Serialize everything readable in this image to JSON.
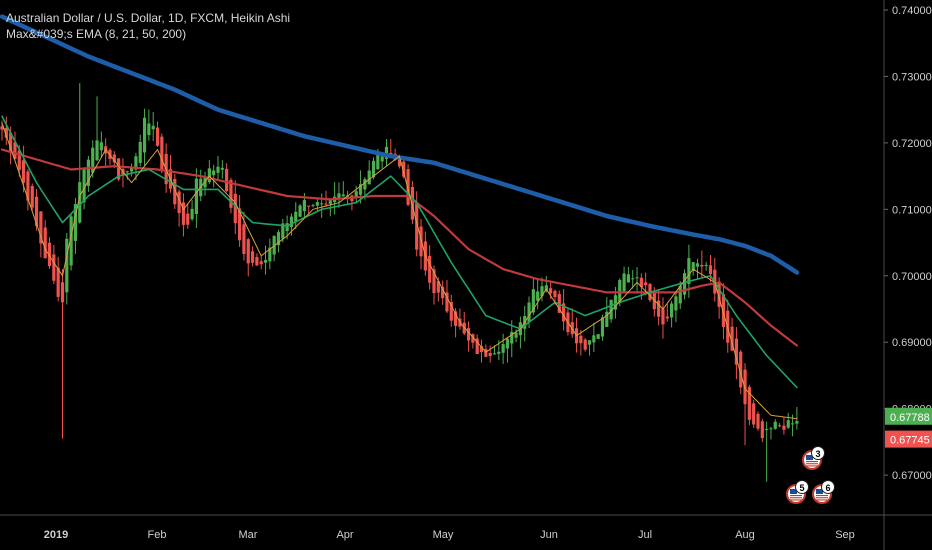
{
  "legend": {
    "symbol_line": "Australian Dollar / U.S. Dollar, 1D, FXCM, Heikin Ashi",
    "indicator_line": "Max&#039;s EMA (8, 21, 50, 200)"
  },
  "colors": {
    "background": "#000000",
    "up": "#4caf50",
    "down": "#ef5350",
    "ema8": "#d8a23a",
    "ema21": "#1fa366",
    "ema50": "#c0393b",
    "ema200": "#1e5ea8",
    "price_up_tag": "#4caf50",
    "price_down_tag": "#ef5350"
  },
  "chart_data": {
    "type": "candlestick",
    "style": "Heikin Ashi",
    "symbol": "AUDUSD",
    "timeframe": "1D",
    "ylim": [
      0.664,
      0.7415
    ],
    "y_ticks": [
      0.67,
      0.68,
      0.69,
      0.7,
      0.71,
      0.72,
      0.73,
      0.74
    ],
    "y_tick_labels": [
      "0.67000",
      "0.68000",
      "0.69000",
      "0.70000",
      "0.71000",
      "0.72000",
      "0.73000",
      "0.74000"
    ],
    "x_ticks": [
      "2019",
      "Feb",
      "Mar",
      "Apr",
      "May",
      "Jun",
      "Jul",
      "Aug",
      "Sep"
    ],
    "price_tags": [
      {
        "label": "0.67788",
        "value": 0.67788,
        "color": "up"
      },
      {
        "label": "0.67745",
        "value": 0.67745,
        "color": "down"
      }
    ],
    "close_keypoints": [
      [
        0,
        0.722
      ],
      [
        3,
        0.718
      ],
      [
        6,
        0.712
      ],
      [
        9,
        0.705
      ],
      [
        12,
        0.699
      ],
      [
        14,
        0.696
      ],
      [
        15,
        0.706
      ],
      [
        18,
        0.714
      ],
      [
        21,
        0.72
      ],
      [
        24,
        0.719
      ],
      [
        27,
        0.715
      ],
      [
        30,
        0.716
      ],
      [
        33,
        0.723
      ],
      [
        35,
        0.723
      ],
      [
        37,
        0.716
      ],
      [
        40,
        0.711
      ],
      [
        43,
        0.707
      ],
      [
        45,
        0.714
      ],
      [
        48,
        0.716
      ],
      [
        51,
        0.716
      ],
      [
        54,
        0.708
      ],
      [
        57,
        0.702
      ],
      [
        60,
        0.701
      ],
      [
        63,
        0.706
      ],
      [
        66,
        0.708
      ],
      [
        69,
        0.711
      ],
      [
        72,
        0.711
      ],
      [
        75,
        0.71
      ],
      [
        78,
        0.712
      ],
      [
        81,
        0.712
      ],
      [
        84,
        0.715
      ],
      [
        87,
        0.718
      ],
      [
        90,
        0.719
      ],
      [
        93,
        0.715
      ],
      [
        96,
        0.704
      ],
      [
        99,
        0.699
      ],
      [
        102,
        0.696
      ],
      [
        105,
        0.693
      ],
      [
        108,
        0.69
      ],
      [
        111,
        0.688
      ],
      [
        114,
        0.689
      ],
      [
        117,
        0.69
      ],
      [
        120,
        0.693
      ],
      [
        123,
        0.698
      ],
      [
        126,
        0.699
      ],
      [
        129,
        0.695
      ],
      [
        132,
        0.691
      ],
      [
        135,
        0.6895
      ],
      [
        138,
        0.692
      ],
      [
        141,
        0.696
      ],
      [
        144,
        0.7
      ],
      [
        147,
        0.7
      ],
      [
        150,
        0.697
      ],
      [
        153,
        0.693
      ],
      [
        156,
        0.697
      ],
      [
        159,
        0.702
      ],
      [
        162,
        0.702
      ],
      [
        164,
        0.7
      ],
      [
        167,
        0.692
      ],
      [
        170,
        0.686
      ],
      [
        173,
        0.678
      ],
      [
        176,
        0.6755
      ],
      [
        179,
        0.6775
      ],
      [
        182,
        0.6775
      ],
      [
        184,
        0.6779
      ]
    ],
    "wick_extremes": [
      {
        "index": 14,
        "low": 0.6755
      },
      {
        "index": 18,
        "high": 0.729
      },
      {
        "index": 22,
        "high": 0.727
      },
      {
        "index": 172,
        "low": 0.6745
      },
      {
        "index": 177,
        "low": 0.669
      }
    ],
    "ema": {
      "ema8": [
        [
          0,
          0.723
        ],
        [
          10,
          0.704
        ],
        [
          14,
          0.7
        ],
        [
          18,
          0.712
        ],
        [
          24,
          0.719
        ],
        [
          30,
          0.714
        ],
        [
          36,
          0.719
        ],
        [
          42,
          0.71
        ],
        [
          48,
          0.715
        ],
        [
          54,
          0.711
        ],
        [
          60,
          0.703
        ],
        [
          66,
          0.706
        ],
        [
          72,
          0.71
        ],
        [
          78,
          0.711
        ],
        [
          84,
          0.714
        ],
        [
          92,
          0.718
        ],
        [
          98,
          0.703
        ],
        [
          106,
          0.693
        ],
        [
          112,
          0.6885
        ],
        [
          120,
          0.692
        ],
        [
          126,
          0.698
        ],
        [
          133,
          0.691
        ],
        [
          140,
          0.694
        ],
        [
          147,
          0.699
        ],
        [
          153,
          0.695
        ],
        [
          160,
          0.701
        ],
        [
          165,
          0.699
        ],
        [
          172,
          0.683
        ],
        [
          178,
          0.679
        ],
        [
          184,
          0.6785
        ]
      ],
      "ema21": [
        [
          0,
          0.724
        ],
        [
          8,
          0.714
        ],
        [
          14,
          0.708
        ],
        [
          20,
          0.712
        ],
        [
          27,
          0.715
        ],
        [
          34,
          0.716
        ],
        [
          42,
          0.713
        ],
        [
          50,
          0.713
        ],
        [
          58,
          0.708
        ],
        [
          66,
          0.7075
        ],
        [
          74,
          0.71
        ],
        [
          82,
          0.711
        ],
        [
          90,
          0.715
        ],
        [
          96,
          0.711
        ],
        [
          104,
          0.702
        ],
        [
          112,
          0.694
        ],
        [
          120,
          0.692
        ],
        [
          128,
          0.696
        ],
        [
          135,
          0.694
        ],
        [
          143,
          0.696
        ],
        [
          150,
          0.6975
        ],
        [
          158,
          0.699
        ],
        [
          164,
          0.7
        ],
        [
          170,
          0.694
        ],
        [
          177,
          0.688
        ],
        [
          184,
          0.6832
        ]
      ],
      "ema50": [
        [
          0,
          0.719
        ],
        [
          8,
          0.7175
        ],
        [
          16,
          0.716
        ],
        [
          26,
          0.7165
        ],
        [
          36,
          0.716
        ],
        [
          46,
          0.715
        ],
        [
          56,
          0.7135
        ],
        [
          66,
          0.712
        ],
        [
          76,
          0.7115
        ],
        [
          86,
          0.712
        ],
        [
          94,
          0.712
        ],
        [
          100,
          0.709
        ],
        [
          108,
          0.704
        ],
        [
          116,
          0.701
        ],
        [
          124,
          0.6995
        ],
        [
          132,
          0.6985
        ],
        [
          140,
          0.6975
        ],
        [
          148,
          0.6975
        ],
        [
          156,
          0.6975
        ],
        [
          162,
          0.6985
        ],
        [
          166,
          0.699
        ],
        [
          172,
          0.696
        ],
        [
          178,
          0.6925
        ],
        [
          184,
          0.6895
        ]
      ],
      "ema200": [
        [
          0,
          0.739
        ],
        [
          10,
          0.736
        ],
        [
          20,
          0.733
        ],
        [
          30,
          0.7305
        ],
        [
          40,
          0.728
        ],
        [
          50,
          0.725
        ],
        [
          60,
          0.723
        ],
        [
          70,
          0.721
        ],
        [
          80,
          0.7195
        ],
        [
          90,
          0.718
        ],
        [
          100,
          0.717
        ],
        [
          110,
          0.715
        ],
        [
          120,
          0.713
        ],
        [
          130,
          0.711
        ],
        [
          140,
          0.709
        ],
        [
          150,
          0.7075
        ],
        [
          160,
          0.7062
        ],
        [
          166,
          0.7055
        ],
        [
          172,
          0.7045
        ],
        [
          178,
          0.703
        ],
        [
          184,
          0.7005
        ]
      ]
    }
  },
  "event_badges": [
    {
      "label": "3",
      "kind": "flag"
    },
    {
      "label": "5",
      "kind": "flag"
    },
    {
      "label": "6",
      "kind": "flag"
    }
  ]
}
